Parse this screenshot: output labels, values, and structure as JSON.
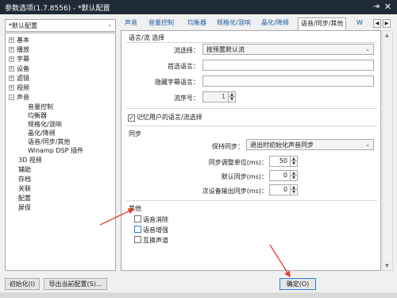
{
  "window": {
    "title": "参数选项(1.7.8556) - *默认配置",
    "pin_label": "⇥",
    "close_label": "✕"
  },
  "preset_select": {
    "value": "*默认配置"
  },
  "tree": {
    "items": [
      {
        "label": "基本",
        "expander": "+"
      },
      {
        "label": "播放",
        "expander": "+"
      },
      {
        "label": "字幕",
        "expander": "+"
      },
      {
        "label": "设备",
        "expander": "+"
      },
      {
        "label": "滤镜",
        "expander": "+"
      },
      {
        "label": "视频",
        "expander": "+"
      },
      {
        "label": "声音",
        "expander": "−"
      },
      {
        "label": "音量控制"
      },
      {
        "label": "均衡器"
      },
      {
        "label": "规格化/混响"
      },
      {
        "label": "晶化/降频"
      },
      {
        "label": "语音/同步/其他"
      },
      {
        "label": "Winamp DSP 插件"
      },
      {
        "label": "3D 视频"
      },
      {
        "label": "辅助"
      },
      {
        "label": "存档"
      },
      {
        "label": "关联"
      },
      {
        "label": "配置"
      },
      {
        "label": "屏保"
      }
    ]
  },
  "tabs": [
    {
      "label": "声音"
    },
    {
      "label": "音量控制"
    },
    {
      "label": "均衡器"
    },
    {
      "label": "规格化/混响"
    },
    {
      "label": "晶化/降频"
    },
    {
      "label": "语音/同步/其他"
    },
    {
      "label": "W"
    }
  ],
  "tab_scroll": {
    "left": "◀",
    "right": "▶"
  },
  "voice_group": {
    "title": "语言/流 选择",
    "stream_select_label": "流选择：",
    "stream_select_value": "按预置默认流",
    "first_lang_label": "首选语言：",
    "first_lang_value": "",
    "hidden_sub_lang_label": "隐藏字幕语言：",
    "hidden_sub_lang_value": "",
    "stream_no_label": "流序号：",
    "stream_no_value": "1",
    "remember_label": "记忆用户的语言/流选择",
    "remember_checked": "✓"
  },
  "sync_group": {
    "title": "同步",
    "keep_sync_label": "保持同步：",
    "keep_sync_value": "退出时初始化声音同步",
    "adjust_unit_label": "同步调整单位(ms)：",
    "adjust_unit_value": "50",
    "default_sync_label": "默认同步(ms)：",
    "default_sync_value": "0",
    "secondary_sync_label": "次设备输出同步(ms)：",
    "secondary_sync_value": "0"
  },
  "other_group": {
    "title": "其他",
    "options": [
      {
        "label": "语音消除"
      },
      {
        "label": "语音增强"
      },
      {
        "label": "互换声道"
      }
    ]
  },
  "spin_arrows": {
    "up": "▲",
    "down": "▼"
  },
  "dropdown_arrow": "⌄",
  "footer": {
    "init_button": "初始化(I)",
    "export_button": "导出当前配置(S)...",
    "ok_button": "确定(O)"
  },
  "annotation_color": "#e8402c"
}
